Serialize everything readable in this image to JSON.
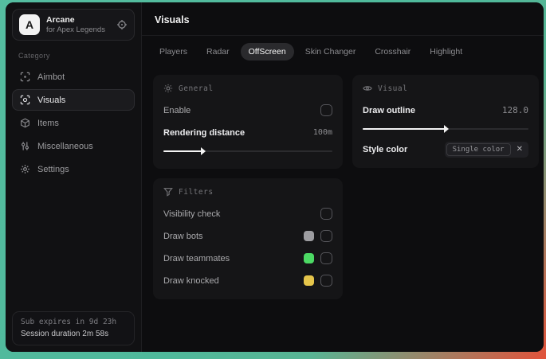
{
  "sidebar": {
    "brand": {
      "logo_letter": "A",
      "title": "Arcane",
      "subtitle": "for Apex Legends"
    },
    "section_label": "Category",
    "items": [
      {
        "label": "Aimbot"
      },
      {
        "label": "Visuals",
        "active": true
      },
      {
        "label": "Items"
      },
      {
        "label": "Miscellaneous"
      },
      {
        "label": "Settings"
      }
    ],
    "footer": {
      "line1": "Sub expires in 9d 23h",
      "line2": "Session duration 2m 58s"
    }
  },
  "header": {
    "title": "Visuals"
  },
  "tabs": {
    "active": "OffScreen",
    "items": [
      {
        "label": "Players"
      },
      {
        "label": "Radar"
      },
      {
        "label": "OffScreen"
      },
      {
        "label": "Skin Changer"
      },
      {
        "label": "Crosshair"
      },
      {
        "label": "Highlight"
      }
    ]
  },
  "panels": {
    "general": {
      "title": "General",
      "enable_label": "Enable",
      "enable_checked": false,
      "rendering_label": "Rendering distance",
      "rendering_value": "100m",
      "rendering_percent": "23%"
    },
    "filters": {
      "title": "Filters",
      "visibility_label": "Visibility check",
      "visibility_checked": false,
      "bots_label": "Draw bots",
      "bots_color": "#9d9da1",
      "bots_checked": false,
      "teammates_label": "Draw teammates",
      "teammates_color": "#4cd964",
      "teammates_checked": false,
      "knocked_label": "Draw knocked",
      "knocked_color": "#e5c54b",
      "knocked_checked": false
    },
    "visual": {
      "title": "Visual",
      "outline_label": "Draw outline",
      "outline_value": "128.0",
      "outline_percent": "50%",
      "style_label": "Style color",
      "style_value": "Single color",
      "remove_icon": "✕"
    }
  },
  "colors": {
    "desktop_teal": "#4fb99b",
    "desktop_red": "#e2523a",
    "panel_bg": "#151517",
    "window_bg": "#0c0c0e",
    "accent_text": "#f2f2f2"
  }
}
